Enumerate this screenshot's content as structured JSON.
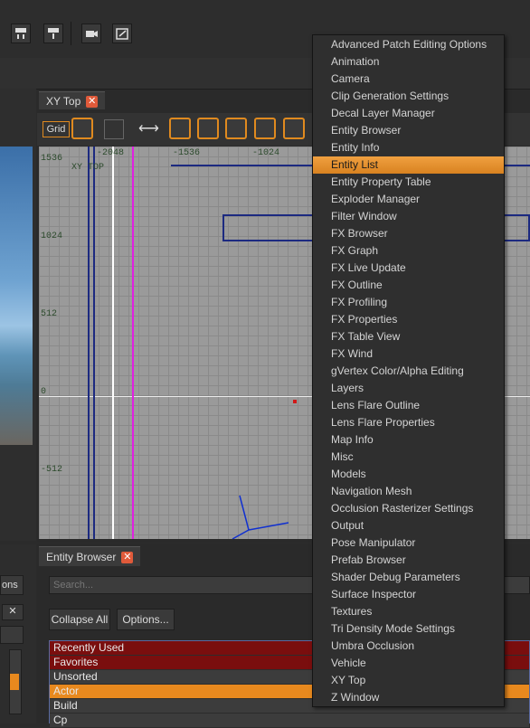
{
  "toolbar": {
    "icons": [
      "patch-down-icon",
      "patch-up-icon",
      "camera-icon",
      "edit-window-icon"
    ]
  },
  "xy_panel": {
    "tab_label": "XY Top",
    "grid_label": "Grid",
    "viewport_label": "XY TOP",
    "tick_labels_top": [
      "-2048",
      "-1536",
      "-1024"
    ],
    "tick_labels_left": [
      "1536",
      "1024",
      "512",
      "0",
      "-512"
    ]
  },
  "left_partial": {
    "options_fragment": "ons"
  },
  "entity_browser": {
    "tab_label": "Entity Browser",
    "search_placeholder": "Search...",
    "collapse_all_label": "Collapse All",
    "options_label": "Options...",
    "list_items": [
      {
        "label": "Recently Used",
        "bg": "#7a0e0e"
      },
      {
        "label": "Favorites",
        "bg": "#7a0e0e"
      },
      {
        "label": "Unsorted",
        "bg": "#3c3c3c"
      },
      {
        "label": "Actor",
        "bg": "#e8891e"
      },
      {
        "label": "Build",
        "bg": "#3c3c3c"
      },
      {
        "label": "Cp",
        "bg": "#3c3c3c"
      }
    ]
  },
  "menu": {
    "selected": "Entity List",
    "items": [
      "Advanced Patch Editing Options",
      "Animation",
      "Camera",
      "Clip Generation Settings",
      "Decal Layer Manager",
      "Entity Browser",
      "Entity Info",
      "Entity List",
      "Entity Property Table",
      "Exploder Manager",
      "Filter Window",
      "FX Browser",
      "FX Graph",
      "FX Live Update",
      "FX Outline",
      "FX Profiling",
      "FX Properties",
      "FX Table View",
      "FX Wind",
      "gVertex Color/Alpha Editing",
      "Layers",
      "Lens Flare Outline",
      "Lens Flare Properties",
      "Map Info",
      "Misc",
      "Models",
      "Navigation Mesh",
      "Occlusion Rasterizer Settings",
      "Output",
      "Pose Manipulator",
      "Prefab Browser",
      "Shader Debug Parameters",
      "Surface Inspector",
      "Textures",
      "Tri Density Mode Settings",
      "Umbra Occlusion",
      "Vehicle",
      "XY Top",
      "Z Window"
    ]
  },
  "colors": {
    "accent_orange": "#e8891e",
    "close_red": "#e05a3a",
    "favorites_red": "#7a0e0e",
    "brush_blue": "#1c2a80",
    "axis_magenta": "#e020e0"
  }
}
